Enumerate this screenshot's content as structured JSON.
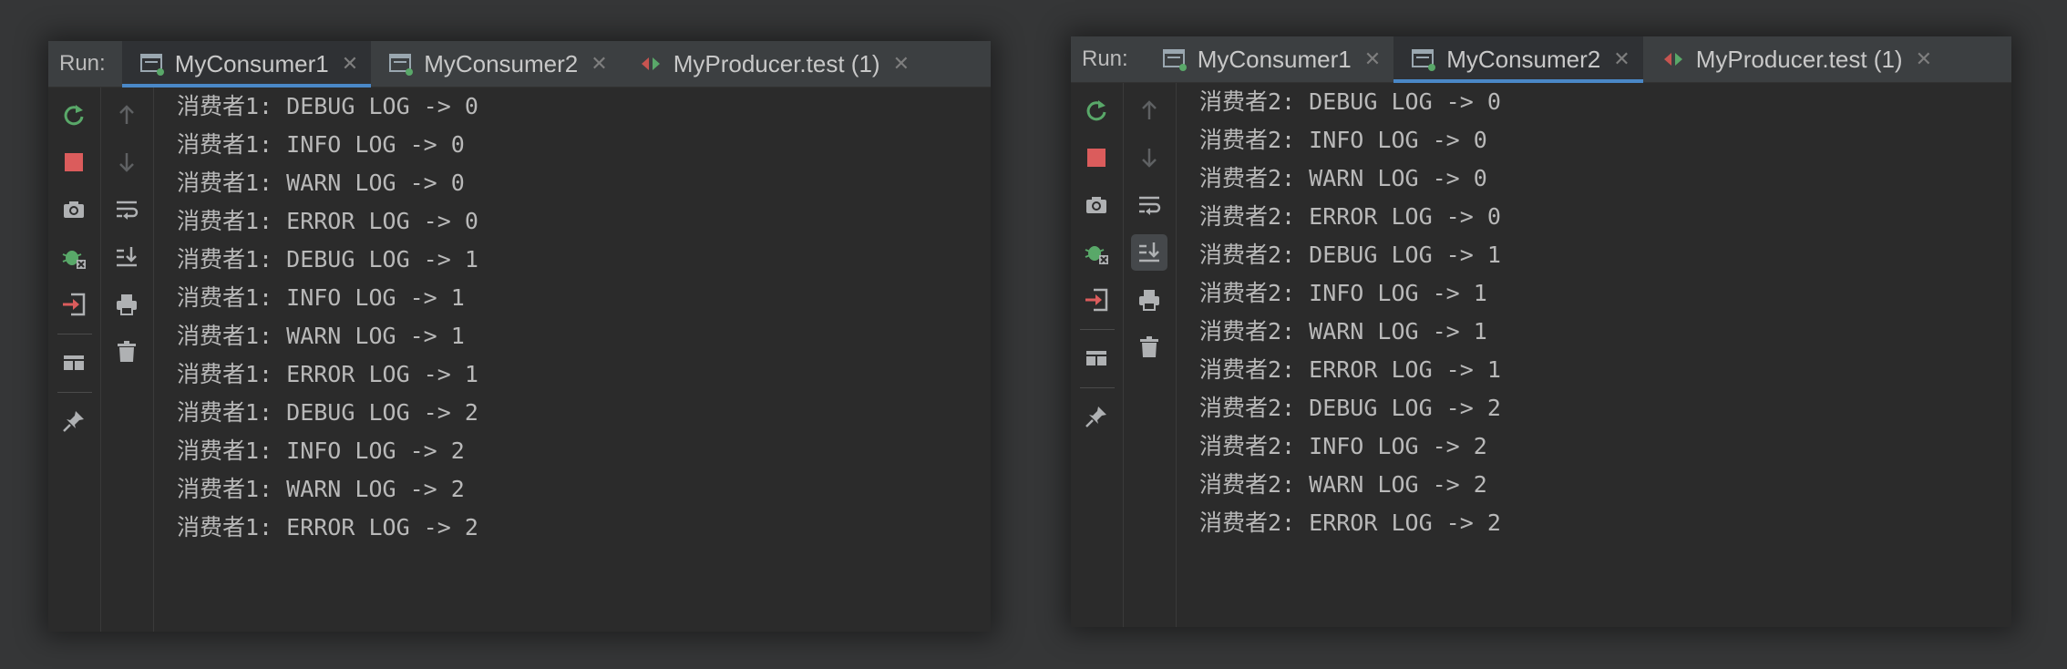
{
  "colors": {
    "background": "#353637",
    "panel": "#2b2b2b",
    "tabbar": "#3c3f41",
    "active_tab_underline": "#4a88c7",
    "text": "#b9b9b9",
    "rerun_green": "#59a869",
    "stop_red": "#db5c5c"
  },
  "icons": {
    "rerun": "rerun-icon",
    "stop": "stop-icon",
    "camera": "camera-icon",
    "debug": "debug-icon",
    "exit": "exit-icon",
    "layout": "layout-icon",
    "pin": "pin-icon",
    "up": "arrow-up-icon",
    "down": "arrow-down-icon",
    "soft_wrap": "soft-wrap-icon",
    "scroll_end": "scroll-to-end-icon",
    "print": "print-icon",
    "trash": "trash-icon"
  },
  "left_panel": {
    "run_label": "Run:",
    "tabs": [
      {
        "label": "MyConsumer1",
        "active": true,
        "icon": "console-icon"
      },
      {
        "label": "MyConsumer2",
        "active": false,
        "icon": "console-icon"
      },
      {
        "label": "MyProducer.test (1)",
        "active": false,
        "icon": "test-icon"
      }
    ],
    "console_lines": [
      "消费者1: DEBUG LOG -> 0",
      "消费者1: INFO LOG -> 0",
      "消费者1: WARN LOG -> 0",
      "消费者1: ERROR LOG -> 0",
      "消费者1: DEBUG LOG -> 1",
      "消费者1: INFO LOG -> 1",
      "消费者1: WARN LOG -> 1",
      "消费者1: ERROR LOG -> 1",
      "消费者1: DEBUG LOG -> 2",
      "消费者1: INFO LOG -> 2",
      "消费者1: WARN LOG -> 2",
      "消费者1: ERROR LOG -> 2"
    ]
  },
  "right_panel": {
    "run_label": "Run:",
    "tabs": [
      {
        "label": "MyConsumer1",
        "active": false,
        "icon": "console-icon"
      },
      {
        "label": "MyConsumer2",
        "active": true,
        "icon": "console-icon"
      },
      {
        "label": "MyProducer.test (1)",
        "active": false,
        "icon": "test-icon"
      }
    ],
    "console_lines": [
      "消费者2: DEBUG LOG -> 0",
      "消费者2: INFO LOG -> 0",
      "消费者2: WARN LOG -> 0",
      "消费者2: ERROR LOG -> 0",
      "消费者2: DEBUG LOG -> 1",
      "消费者2: INFO LOG -> 1",
      "消费者2: WARN LOG -> 1",
      "消费者2: ERROR LOG -> 1",
      "消费者2: DEBUG LOG -> 2",
      "消费者2: INFO LOG -> 2",
      "消费者2: WARN LOG -> 2",
      "消费者2: ERROR LOG -> 2"
    ]
  }
}
